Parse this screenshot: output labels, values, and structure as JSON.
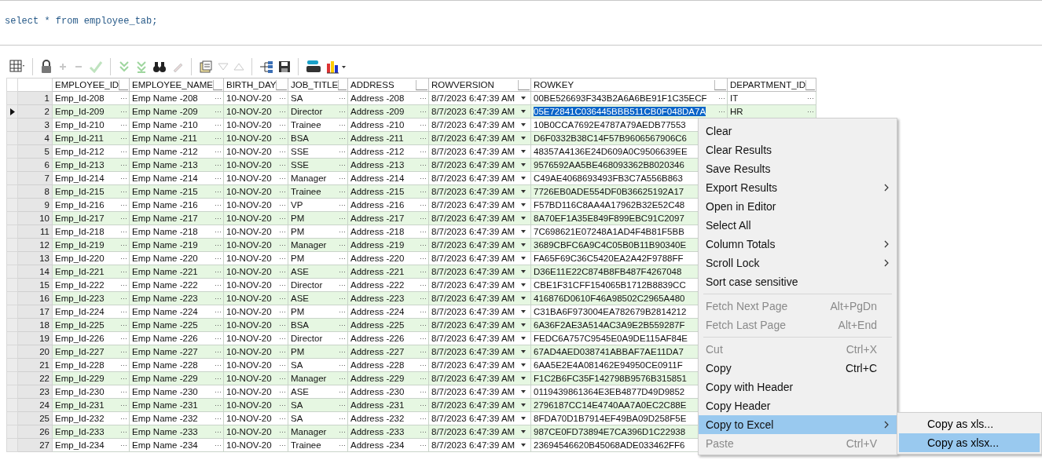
{
  "editor": {
    "sql": "select * from employee_tab;"
  },
  "grid": {
    "columns": [
      {
        "label": "EMPLOYEE_ID",
        "kind": "text"
      },
      {
        "label": "EMPLOYEE_NAME",
        "kind": "text"
      },
      {
        "label": "BIRTH_DAY",
        "kind": "text"
      },
      {
        "label": "JOB_TITLE",
        "kind": "text"
      },
      {
        "label": "ADDRESS",
        "kind": "text"
      },
      {
        "label": "ROWVERSION",
        "kind": "dropdown"
      },
      {
        "label": "ROWKEY",
        "kind": "text",
        "focused": true
      },
      {
        "label": "DEPARTMENT_ID",
        "kind": "text"
      }
    ],
    "rows": [
      {
        "number": "1",
        "selected": false,
        "cells": [
          "Emp_Id-208",
          "Emp Name -208",
          "10-NOV-20",
          "SA",
          "Address -208",
          "8/7/2023 6:47:39 AM",
          "00BE526693F343B2A6A6BE91F1C35ECF",
          "IT"
        ]
      },
      {
        "number": "2",
        "selected": true,
        "cells": [
          "Emp_Id-209",
          "Emp Name -209",
          "10-NOV-20",
          "Director",
          "Address -209",
          "8/7/2023 6:47:39 AM",
          "05E72841C036445BBB511CB0F048DA7A",
          "HR"
        ]
      },
      {
        "number": "3",
        "selected": false,
        "cells": [
          "Emp_Id-210",
          "Emp Name -210",
          "10-NOV-20",
          "Trainee",
          "Address -210",
          "8/7/2023 6:47:39 AM",
          "10B0CCA7692E4787A79AEDB77553"
        ]
      },
      {
        "number": "4",
        "selected": false,
        "cells": [
          "Emp_Id-211",
          "Emp Name -211",
          "10-NOV-20",
          "BSA",
          "Address -211",
          "8/7/2023 6:47:39 AM",
          "D6F0332B38C14F57B9606567906C6"
        ]
      },
      {
        "number": "5",
        "selected": false,
        "cells": [
          "Emp_Id-212",
          "Emp Name -212",
          "10-NOV-20",
          "SSE",
          "Address -212",
          "8/7/2023 6:47:39 AM",
          "48357A4136E24D609A0C9506639EE"
        ]
      },
      {
        "number": "6",
        "selected": false,
        "cells": [
          "Emp_Id-213",
          "Emp Name -213",
          "10-NOV-20",
          "SSE",
          "Address -213",
          "8/7/2023 6:47:39 AM",
          "9576592AA5BE468093362B8020346"
        ]
      },
      {
        "number": "7",
        "selected": false,
        "cells": [
          "Emp_Id-214",
          "Emp Name -214",
          "10-NOV-20",
          "Manager",
          "Address -214",
          "8/7/2023 6:47:39 AM",
          "C49AE4068693493FB3C7A556B863"
        ]
      },
      {
        "number": "8",
        "selected": false,
        "cells": [
          "Emp_Id-215",
          "Emp Name -215",
          "10-NOV-20",
          "Trainee",
          "Address -215",
          "8/7/2023 6:47:39 AM",
          "7726EB0ADE554DF0B36625192A17"
        ]
      },
      {
        "number": "9",
        "selected": false,
        "cells": [
          "Emp_Id-216",
          "Emp Name -216",
          "10-NOV-20",
          "VP",
          "Address -216",
          "8/7/2023 6:47:39 AM",
          "F57BD116C8AA4A17962B32E52C48"
        ]
      },
      {
        "number": "10",
        "selected": false,
        "cells": [
          "Emp_Id-217",
          "Emp Name -217",
          "10-NOV-20",
          "PM",
          "Address -217",
          "8/7/2023 6:47:39 AM",
          "8A70EF1A35E849F899EBC91C2097"
        ]
      },
      {
        "number": "11",
        "selected": false,
        "cells": [
          "Emp_Id-218",
          "Emp Name -218",
          "10-NOV-20",
          "PM",
          "Address -218",
          "8/7/2023 6:47:39 AM",
          "7C698621E07248A1AD4F4B81F5BB"
        ]
      },
      {
        "number": "12",
        "selected": false,
        "cells": [
          "Emp_Id-219",
          "Emp Name -219",
          "10-NOV-20",
          "Manager",
          "Address -219",
          "8/7/2023 6:47:39 AM",
          "3689CBFC6A9C4C05B0B11B90340E"
        ]
      },
      {
        "number": "13",
        "selected": false,
        "cells": [
          "Emp_Id-220",
          "Emp Name -220",
          "10-NOV-20",
          "PM",
          "Address -220",
          "8/7/2023 6:47:39 AM",
          "FA65F69C36C5420EA2A42F9788FF"
        ]
      },
      {
        "number": "14",
        "selected": false,
        "cells": [
          "Emp_Id-221",
          "Emp Name -221",
          "10-NOV-20",
          "ASE",
          "Address -221",
          "8/7/2023 6:47:39 AM",
          "D36E11E22C874B8FB487F4267048"
        ]
      },
      {
        "number": "15",
        "selected": false,
        "cells": [
          "Emp_Id-222",
          "Emp Name -222",
          "10-NOV-20",
          "Director",
          "Address -222",
          "8/7/2023 6:47:39 AM",
          "CBE1F31CFF154065B1712B8839CC"
        ]
      },
      {
        "number": "16",
        "selected": false,
        "cells": [
          "Emp_Id-223",
          "Emp Name -223",
          "10-NOV-20",
          "ASE",
          "Address -223",
          "8/7/2023 6:47:39 AM",
          "416876D0610F46A98502C2965A480"
        ]
      },
      {
        "number": "17",
        "selected": false,
        "cells": [
          "Emp_Id-224",
          "Emp Name -224",
          "10-NOV-20",
          "PM",
          "Address -224",
          "8/7/2023 6:47:39 AM",
          "C31BA6F973004EA782679B2814212"
        ]
      },
      {
        "number": "18",
        "selected": false,
        "cells": [
          "Emp_Id-225",
          "Emp Name -225",
          "10-NOV-20",
          "BSA",
          "Address -225",
          "8/7/2023 6:47:39 AM",
          "6A36F2AE3A514AC3A9E2B559287F"
        ]
      },
      {
        "number": "19",
        "selected": false,
        "cells": [
          "Emp_Id-226",
          "Emp Name -226",
          "10-NOV-20",
          "Director",
          "Address -226",
          "8/7/2023 6:47:39 AM",
          "FEDC6A757C9545E0A9DE115AF84E"
        ]
      },
      {
        "number": "20",
        "selected": false,
        "cells": [
          "Emp_Id-227",
          "Emp Name -227",
          "10-NOV-20",
          "PM",
          "Address -227",
          "8/7/2023 6:47:39 AM",
          "67AD4AED038741ABBAF7AE11DA7"
        ]
      },
      {
        "number": "21",
        "selected": false,
        "cells": [
          "Emp_Id-228",
          "Emp Name -228",
          "10-NOV-20",
          "SA",
          "Address -228",
          "8/7/2023 6:47:39 AM",
          "6AA5E2E4A081462E94950CE0911F"
        ]
      },
      {
        "number": "22",
        "selected": false,
        "cells": [
          "Emp_Id-229",
          "Emp Name -229",
          "10-NOV-20",
          "Manager",
          "Address -229",
          "8/7/2023 6:47:39 AM",
          "F1C2B6FC35F142798B9576B315851"
        ]
      },
      {
        "number": "23",
        "selected": false,
        "cells": [
          "Emp_Id-230",
          "Emp Name -230",
          "10-NOV-20",
          "ASE",
          "Address -230",
          "8/7/2023 6:47:39 AM",
          "0119439861364E3EB4877D49D9852"
        ]
      },
      {
        "number": "24",
        "selected": false,
        "cells": [
          "Emp_Id-231",
          "Emp Name -231",
          "10-NOV-20",
          "SA",
          "Address -231",
          "8/7/2023 6:47:39 AM",
          "2796187CC14E4740AA7A0EC2C88E"
        ]
      },
      {
        "number": "25",
        "selected": false,
        "cells": [
          "Emp_Id-232",
          "Emp Name -232",
          "10-NOV-20",
          "SA",
          "Address -232",
          "8/7/2023 6:47:39 AM",
          "8FDA70D1B7914EF49BA09D258F5E"
        ]
      },
      {
        "number": "26",
        "selected": false,
        "cells": [
          "Emp_Id-233",
          "Emp Name -233",
          "10-NOV-20",
          "Manager",
          "Address -233",
          "8/7/2023 6:47:39 AM",
          "987CE0FD73894E7CA396D1C22938"
        ]
      },
      {
        "number": "27",
        "selected": false,
        "cells": [
          "Emp_Id-234",
          "Emp Name -234",
          "10-NOV-20",
          "Trainee",
          "Address -234",
          "8/7/2023 6:47:39 AM",
          "23694546620B45068ADE033462FF6"
        ]
      }
    ]
  },
  "context_menu": {
    "items": [
      {
        "kind": "item",
        "label": "Clear",
        "disabled": false,
        "submenu": false,
        "selected": false
      },
      {
        "kind": "item",
        "label": "Clear Results",
        "disabled": false,
        "submenu": false,
        "selected": false
      },
      {
        "kind": "item",
        "label": "Save Results",
        "disabled": false,
        "submenu": false,
        "selected": false
      },
      {
        "kind": "item",
        "label": "Export Results",
        "disabled": false,
        "submenu": true,
        "selected": false
      },
      {
        "kind": "item",
        "label": "Open in Editor",
        "disabled": false,
        "submenu": false,
        "selected": false
      },
      {
        "kind": "item",
        "label": "Select All",
        "disabled": false,
        "submenu": false,
        "selected": false
      },
      {
        "kind": "item",
        "label": "Column Totals",
        "disabled": false,
        "submenu": true,
        "selected": false
      },
      {
        "kind": "item",
        "label": "Scroll Lock",
        "disabled": false,
        "submenu": true,
        "selected": false
      },
      {
        "kind": "item",
        "label": "Sort case sensitive",
        "disabled": false,
        "submenu": false,
        "selected": false
      },
      {
        "kind": "separator"
      },
      {
        "kind": "item",
        "label": "Fetch Next Page",
        "shortcut": "Alt+PgDn",
        "disabled": true,
        "submenu": false,
        "selected": false
      },
      {
        "kind": "item",
        "label": "Fetch Last Page",
        "shortcut": "Alt+End",
        "disabled": true,
        "submenu": false,
        "selected": false
      },
      {
        "kind": "separator"
      },
      {
        "kind": "item",
        "label": "Cut",
        "shortcut": "Ctrl+X",
        "disabled": true,
        "submenu": false,
        "selected": false
      },
      {
        "kind": "item",
        "label": "Copy",
        "shortcut": "Ctrl+C",
        "disabled": false,
        "submenu": false,
        "selected": false
      },
      {
        "kind": "item",
        "label": "Copy with Header",
        "disabled": false,
        "submenu": false,
        "selected": false
      },
      {
        "kind": "item",
        "label": "Copy Header",
        "disabled": false,
        "submenu": false,
        "selected": false
      },
      {
        "kind": "item",
        "label": "Copy to Excel",
        "disabled": false,
        "submenu": true,
        "selected": true
      },
      {
        "kind": "item",
        "label": "Paste",
        "shortcut": "Ctrl+V",
        "disabled": true,
        "submenu": false,
        "selected": false
      }
    ]
  },
  "submenu": {
    "items": [
      {
        "label": "Copy as xls...",
        "selected": false
      },
      {
        "label": "Copy as xlsx...",
        "selected": true
      }
    ]
  }
}
